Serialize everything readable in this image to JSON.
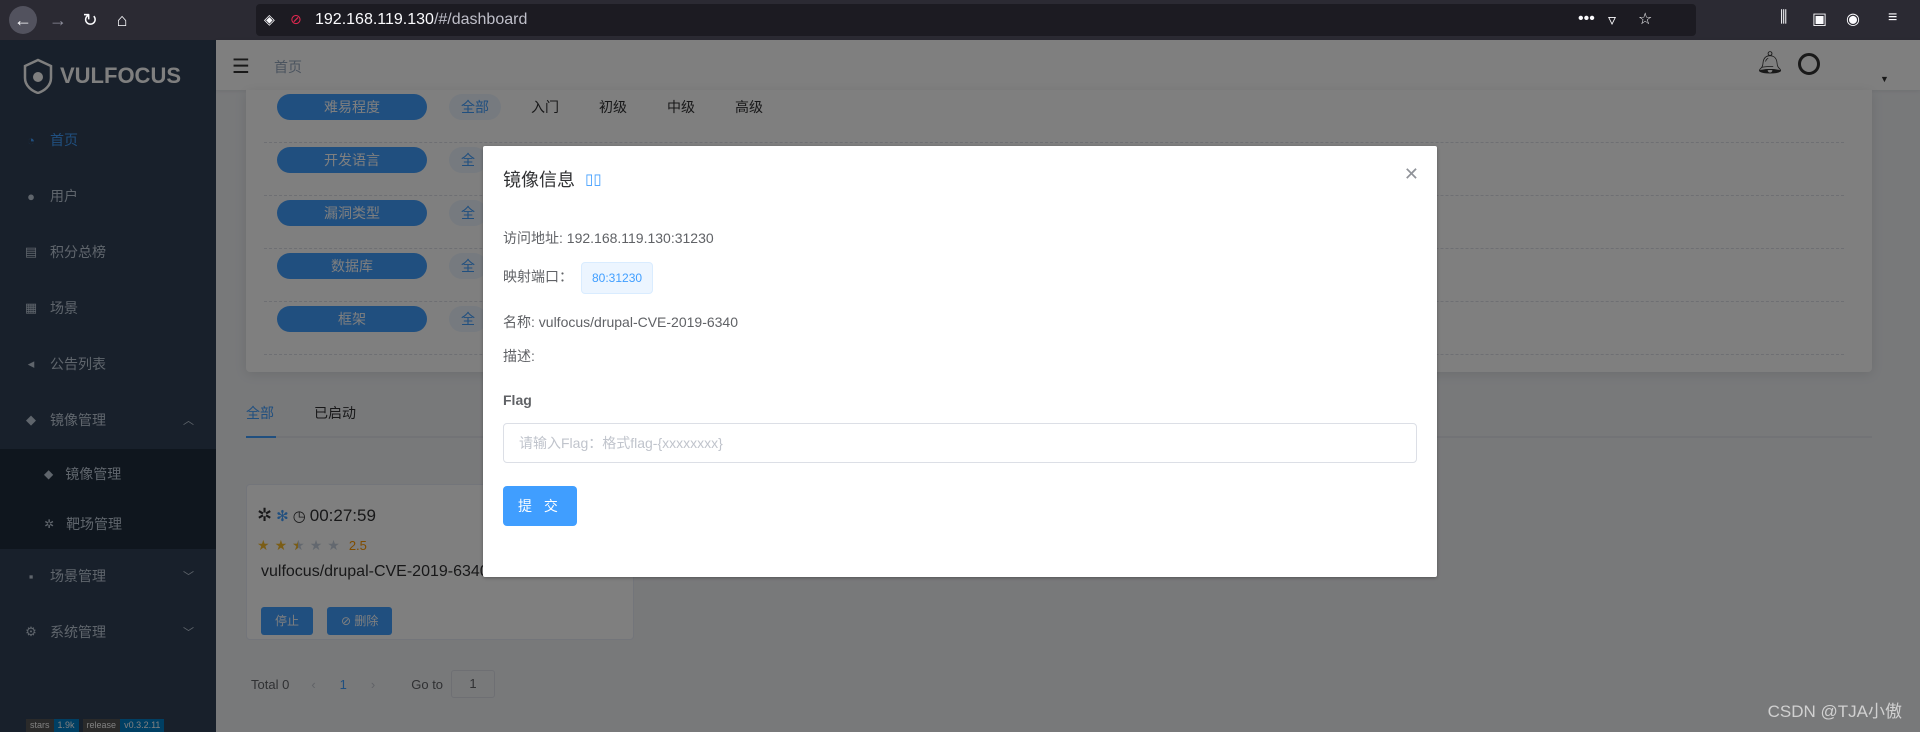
{
  "browser": {
    "url_host": "192.168.119.130",
    "url_path": "/#/dashboard"
  },
  "sidebar": {
    "logo": "VULFOCUS",
    "items": [
      {
        "label": "首页",
        "icon": "dashboard-icon"
      },
      {
        "label": "用户",
        "icon": "user-icon"
      },
      {
        "label": "积分总榜",
        "icon": "list-icon"
      },
      {
        "label": "场景",
        "icon": "grid-icon"
      },
      {
        "label": "公告列表",
        "icon": "megaphone-icon"
      },
      {
        "label": "镜像管理",
        "icon": "docker-icon"
      },
      {
        "label": "场景管理",
        "icon": "folder-icon"
      },
      {
        "label": "系统管理",
        "icon": "gear-icon"
      }
    ],
    "submenu": [
      {
        "label": "镜像管理",
        "icon": "docker-icon"
      },
      {
        "label": "靶场管理",
        "icon": "bug-icon"
      }
    ],
    "badges": [
      {
        "left": "stars",
        "right": "1.9k"
      },
      {
        "left": "release",
        "right": "v0.3.2.11"
      }
    ]
  },
  "header": {
    "breadcrumb": "首页"
  },
  "filters": [
    {
      "label": "难易程度",
      "options": [
        "全部",
        "入门",
        "初级",
        "中级",
        "高级"
      ]
    },
    {
      "label": "开发语言",
      "options": [
        "全"
      ]
    },
    {
      "label": "漏洞类型",
      "options": [
        "全"
      ]
    },
    {
      "label": "数据库",
      "options": [
        "全"
      ]
    },
    {
      "label": "框架",
      "options": [
        "全"
      ]
    }
  ],
  "tabs": [
    "全部",
    "已启动"
  ],
  "card": {
    "timer": "00:27:59",
    "rating": 2.5,
    "score": "2.5",
    "name": "vulfocus/drupal-CVE-2019-6340",
    "stop": "停止",
    "delete": "删除"
  },
  "pager": {
    "total": "Total 0",
    "page": "1",
    "goto_label": "Go to",
    "goto_value": "1"
  },
  "dialog": {
    "title": "镜像信息",
    "address_label": "访问地址: ",
    "address": "192.168.119.130:31230",
    "port_label": "映射端口：",
    "port": "80:31230",
    "name_label": "名称: ",
    "name": "vulfocus/drupal-CVE-2019-6340",
    "desc_label": "描述:",
    "flag_label": "Flag",
    "flag_placeholder": "请输入Flag：格式flag-{xxxxxxxx}",
    "submit": "提 交"
  },
  "watermark": "CSDN @TJA小傲",
  "colors": {
    "primary": "#409eff",
    "sidebar": "#304156",
    "star": "#f7ba2a"
  }
}
